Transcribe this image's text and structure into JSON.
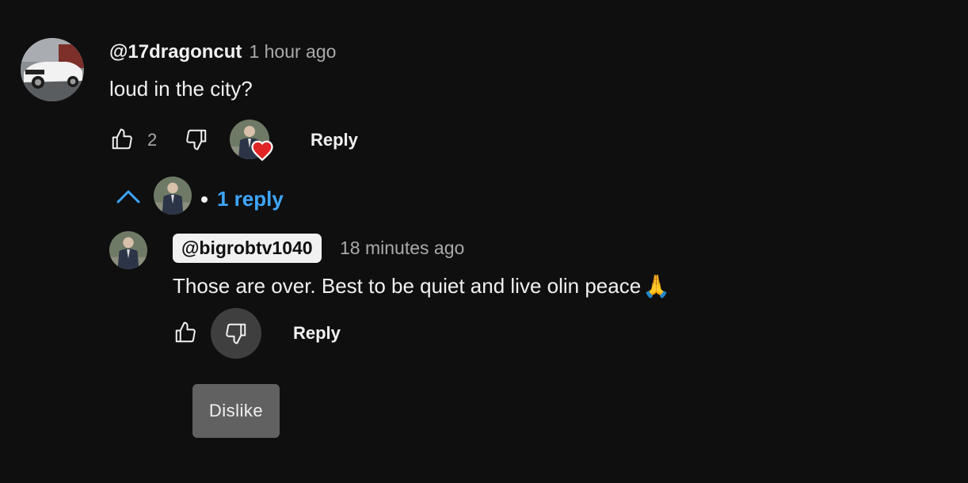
{
  "comment": {
    "author": "@17dragoncut",
    "timestamp": "1 hour ago",
    "text": "loud in the city?",
    "like_count": "2",
    "reply_label": "Reply",
    "creator_hearted": true
  },
  "replies_toggle": {
    "label": "1 reply",
    "expanded": true
  },
  "reply": {
    "author": "@bigrobtv1040",
    "timestamp": "18 minutes ago",
    "text": "Those are over. Best to be quiet and live olin peace",
    "emoji": "🙏",
    "reply_label": "Reply"
  },
  "tooltip": {
    "text": "Dislike"
  },
  "colors": {
    "background": "#0f0f0f",
    "link_blue": "#3ea6ff",
    "heart_red": "#e02424",
    "tooltip_bg": "#616161"
  },
  "icons": {
    "like": "thumbs-up-icon",
    "dislike": "thumbs-down-icon",
    "collapse": "chevron-up-icon",
    "heart": "heart-icon"
  }
}
